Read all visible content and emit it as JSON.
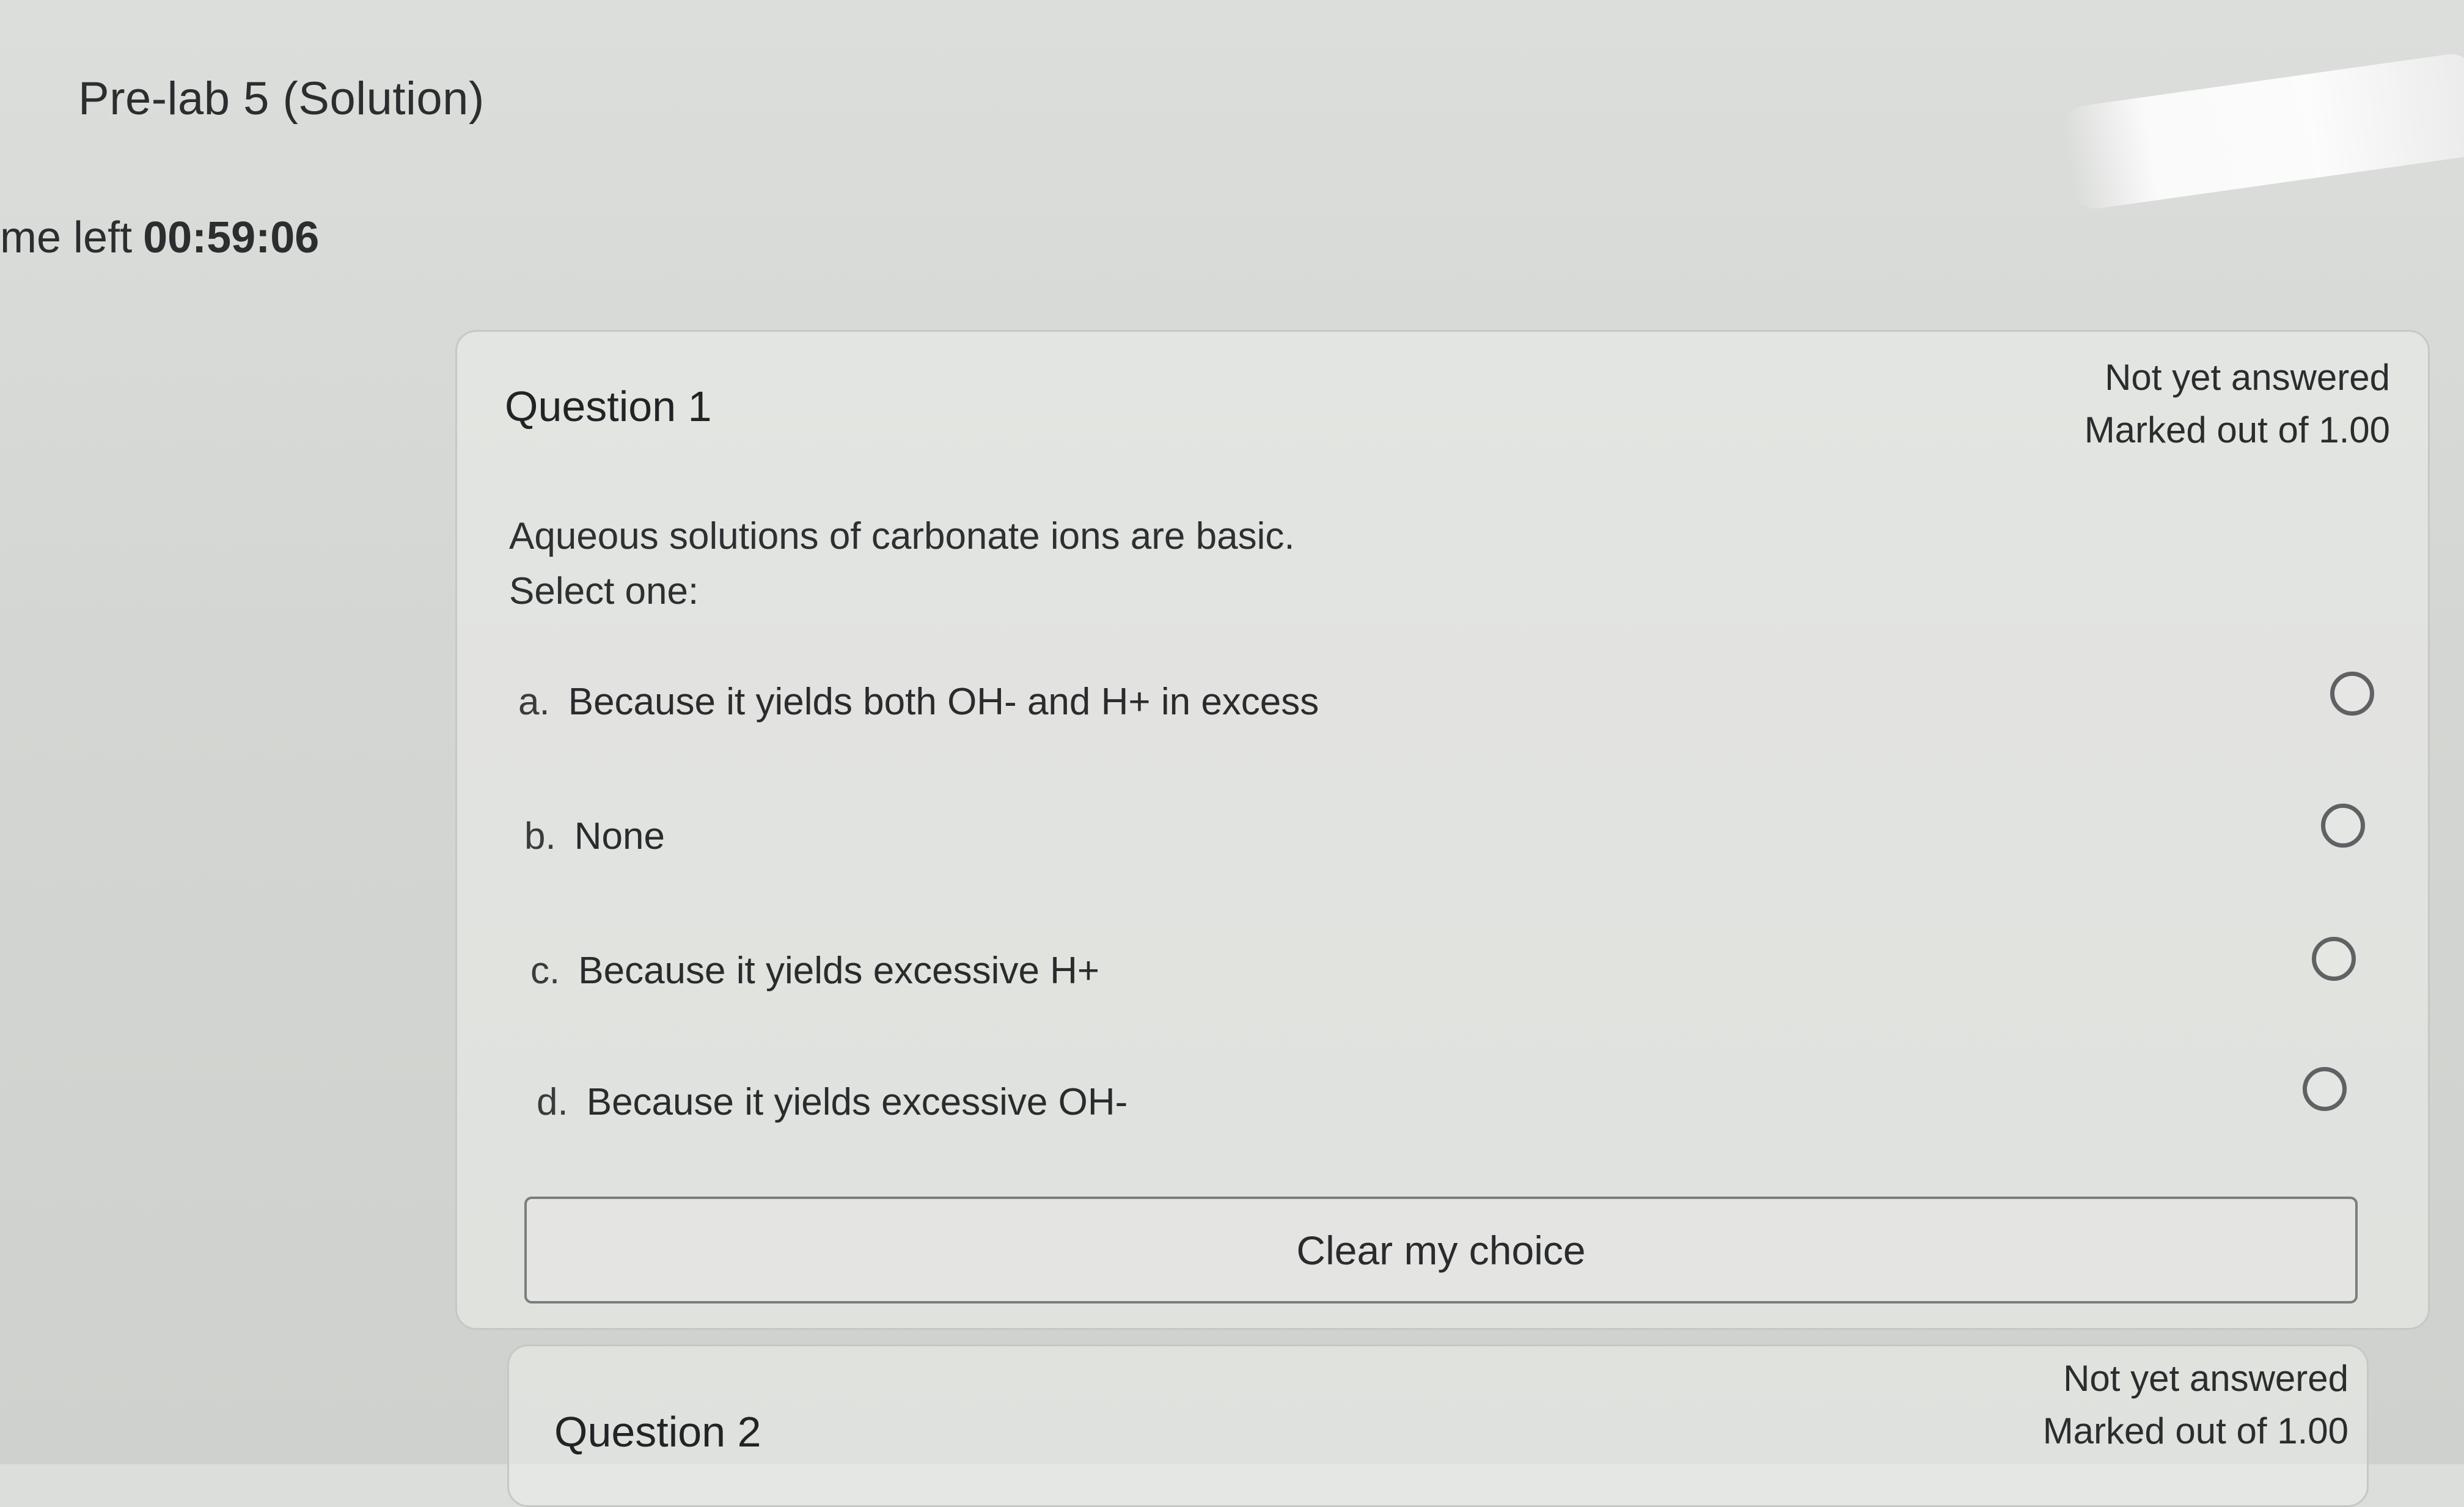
{
  "page": {
    "title": "Pre-lab 5 (Solution)",
    "timer_label": "me left",
    "timer_value": "00:59:06"
  },
  "question1": {
    "heading": "Question 1",
    "status": "Not yet answered",
    "marks": "Marked out of 1.00",
    "text": "Aqueous solutions of carbonate ions are basic.",
    "prompt": "Select one:",
    "options": [
      {
        "letter": "a.",
        "label": "Because it yields both OH- and H+ in excess",
        "selected": false
      },
      {
        "letter": "b.",
        "label": "None",
        "selected": false
      },
      {
        "letter": "c.",
        "label": "Because it yields excessive H+",
        "selected": false
      },
      {
        "letter": "d.",
        "label": "Because it yields excessive OH-",
        "selected": false
      }
    ],
    "clear_label": "Clear my choice"
  },
  "question2": {
    "heading": "Question 2",
    "status": "Not yet answered",
    "marks": "Marked out of 1.00"
  }
}
